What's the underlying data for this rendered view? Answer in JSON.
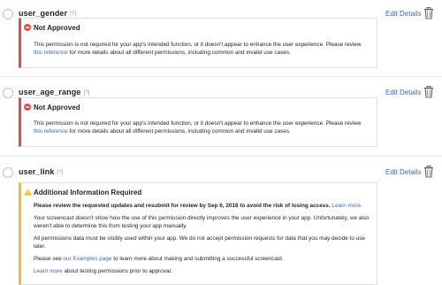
{
  "permissions": [
    {
      "name": "user_gender",
      "help": "[?]",
      "edit_label": "Edit Details",
      "status_title": "Not Approved",
      "p1": "This permission is not required for your app's intended function, or it doesn't appear to enhance the user experience. Please review ",
      "p1_link1": "this",
      "p1_link2": "reference",
      "p1_tail": " for more details about all different permissions, including common and invalid use cases."
    },
    {
      "name": "user_age_range",
      "help": "[?]",
      "edit_label": "Edit Details",
      "status_title": "Not Approved",
      "p1": "This permission is not required for your app's intended function, or it doesn't appear to enhance the user experience. Please review ",
      "p1_link1": "this",
      "p1_link2": "reference",
      "p1_tail": " for more details about all different permissions, including common and invalid use cases."
    },
    {
      "name": "user_link",
      "help": "[?]",
      "edit_label": "Edit Details",
      "status_title": "Additional Information Required",
      "resubmit_bold": "Please review the requested updates and resubmit for review by Sep 6, 2018 to avoid the risk of losing access.",
      "learn_more": "Learn more.",
      "p2": "Your screencast doesn't show how the use of this permission directly improves the user experience in your app. Unfortunately, we also weren't able to determine this from testing your app manually.",
      "p3": "All permissions data must be visibly used within your app. We do not accept permission requests for data that you may decide to use later.",
      "p4_pre": "Please see ",
      "p4_link": "our Examples page",
      "p4_post": " to learn more about making and submitting a successful screencast.",
      "p5_link": "Learn more",
      "p5_post": " about testing permissions prior to approval."
    }
  ],
  "colors": {
    "error": "#e5484d",
    "warning": "#f7b928",
    "link": "#4267b2"
  },
  "icons": [
    "trash-icon",
    "error-circle-icon",
    "warning-triangle-icon"
  ]
}
